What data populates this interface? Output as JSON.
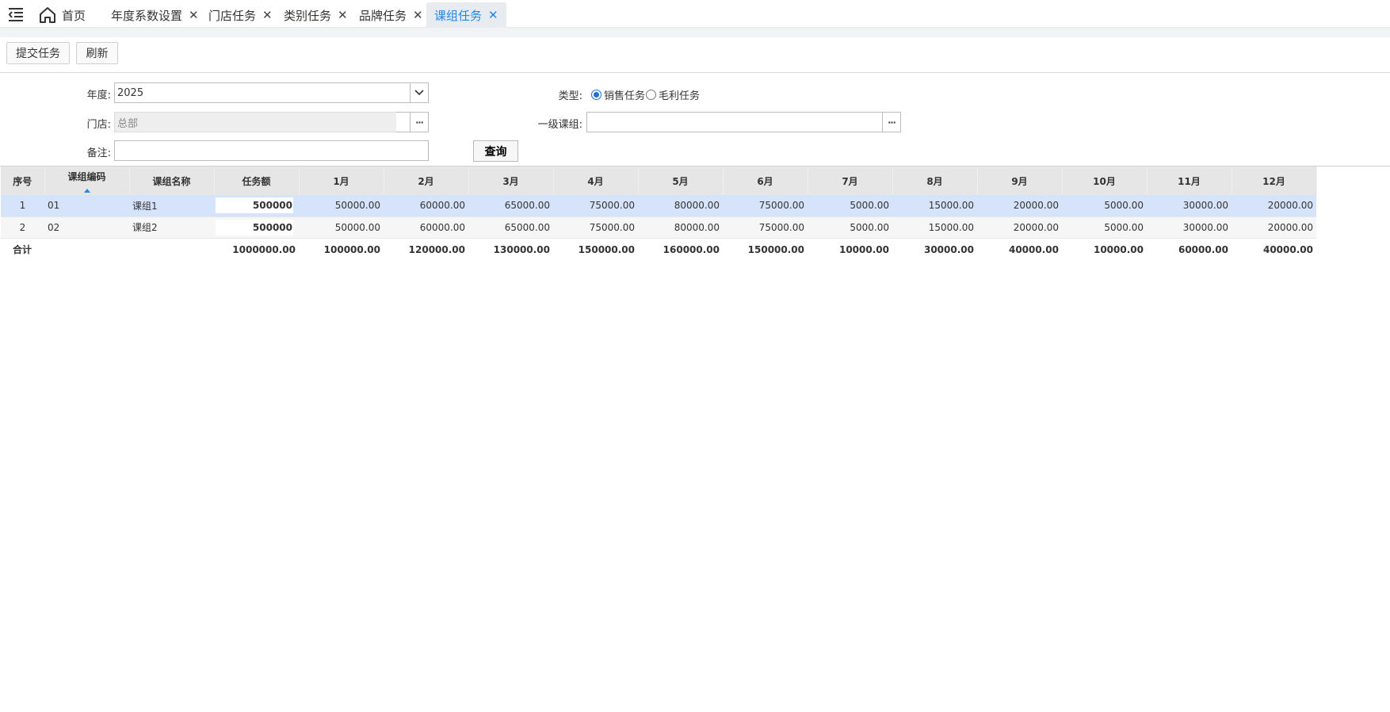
{
  "tabs": {
    "home_label": "首页",
    "items": [
      {
        "label": "年度系数设置",
        "close": "✕"
      },
      {
        "label": "门店任务",
        "close": "✕"
      },
      {
        "label": "类别任务",
        "close": "✕"
      },
      {
        "label": "品牌任务",
        "close": "✕"
      },
      {
        "label": "课组任务",
        "close": "✕"
      }
    ],
    "active_index": 4
  },
  "toolbar": {
    "submit_label": "提交任务",
    "refresh_label": "刷新"
  },
  "form": {
    "year_label": "年度:",
    "year_value": "2025",
    "store_label": "门店:",
    "store_value": "总部",
    "remark_label": "备注:",
    "remark_value": "",
    "type_label": "类型:",
    "type_options": [
      "销售任务",
      "毛利任务"
    ],
    "type_selected": "销售任务",
    "group_label": "一级课组:",
    "group_value": "",
    "query_label": "查询",
    "ellipsis": "···"
  },
  "grid": {
    "headers": [
      "序号",
      "课组编码",
      "课组名称",
      "任务额",
      "1月",
      "2月",
      "3月",
      "4月",
      "5月",
      "6月",
      "7月",
      "8月",
      "9月",
      "10月",
      "11月",
      "12月"
    ],
    "rows": [
      {
        "seq": "1",
        "code": "01",
        "name": "课组1",
        "amount": "500000",
        "months": [
          "50000.00",
          "60000.00",
          "65000.00",
          "75000.00",
          "80000.00",
          "75000.00",
          "5000.00",
          "15000.00",
          "20000.00",
          "5000.00",
          "30000.00",
          "20000.00"
        ]
      },
      {
        "seq": "2",
        "code": "02",
        "name": "课组2",
        "amount": "500000",
        "months": [
          "50000.00",
          "60000.00",
          "65000.00",
          "75000.00",
          "80000.00",
          "75000.00",
          "5000.00",
          "15000.00",
          "20000.00",
          "5000.00",
          "30000.00",
          "20000.00"
        ]
      }
    ],
    "total": {
      "label": "合计",
      "amount": "1000000.00",
      "months": [
        "100000.00",
        "120000.00",
        "130000.00",
        "150000.00",
        "160000.00",
        "150000.00",
        "10000.00",
        "30000.00",
        "40000.00",
        "10000.00",
        "60000.00",
        "40000.00"
      ]
    }
  },
  "colors": {
    "accent": "#1e87f0",
    "selected_row": "#d6e4fb",
    "header_bg": "#e6e6e6"
  }
}
